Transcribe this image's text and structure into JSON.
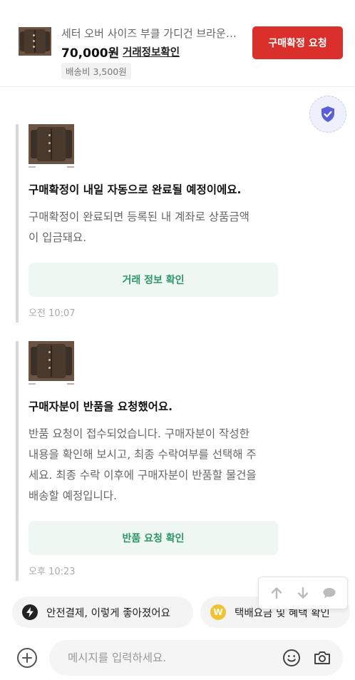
{
  "header": {
    "product_title": "세터 오버 사이즈 부클 가디건 브라운…",
    "price": "70,000원",
    "trade_info_link": "거래정보확인",
    "shipping_fee": "배송비 3,500원",
    "confirm_button": "구매확정 요청"
  },
  "messages": [
    {
      "title": "구매확정이 내일 자동으로 완료될 예정이에요.",
      "body": "구매확정이 완료되면 등록된 내 계좌로 상품금액\n이 입금돼요.",
      "button": "거래 정보 확인",
      "time": "오전 10:07"
    },
    {
      "title": "구매자분이 반품을 요청했어요.",
      "body": "반품 요청이 접수되었습니다. 구매자분이 작성한\n내용을 확인해 보시고, 최종 수락여부를 선택해 주\n세요. 최종 수락 이후에 구매자분이 반품할 물건을\n 배송할 예정입니다.",
      "button": "반품 요청 확인",
      "time": "오후 10:23"
    }
  ],
  "chips": [
    {
      "label": "안전결제, 이렇게 좋아졌어요",
      "icon": "lightning-icon"
    },
    {
      "label": "택배요금 및 혜택 확인",
      "icon": "w-coin-icon"
    }
  ],
  "input": {
    "placeholder": "메시지를 입력하세요."
  },
  "colors": {
    "accent_red": "#d9302c",
    "green_text": "#2e9567",
    "green_bg": "#eef7f2",
    "shield_purple": "#5b5fd6",
    "coin_yellow": "#f2c230"
  }
}
